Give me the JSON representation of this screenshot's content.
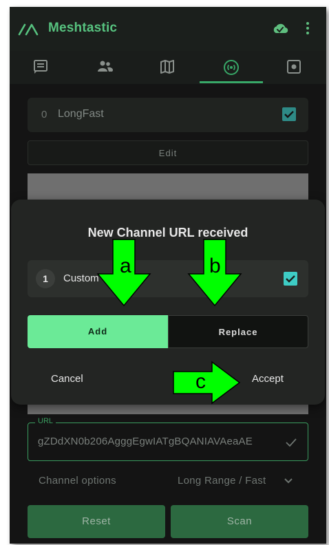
{
  "app": {
    "title": "Meshtastic"
  },
  "tabs": [
    {
      "icon": "chat-icon"
    },
    {
      "icon": "people-icon"
    },
    {
      "icon": "map-icon"
    },
    {
      "icon": "channel-icon",
      "selected": true
    },
    {
      "icon": "settings-icon"
    }
  ],
  "channels": [
    {
      "index": "0",
      "name": "LongFast"
    }
  ],
  "edit_label": "Edit",
  "url_field": {
    "label": "URL",
    "value": "gZDdXN0b206AgggEgwIATgBQANIAVAeaAE"
  },
  "channel_options": {
    "label": "Channel options",
    "value": "Long Range / Fast"
  },
  "buttons": {
    "reset": "Reset",
    "scan": "Scan"
  },
  "dialog": {
    "title": "New Channel URL received",
    "channel": {
      "index": "1",
      "name": "Custom"
    },
    "add": "Add",
    "replace": "Replace",
    "cancel": "Cancel",
    "accept": "Accept"
  },
  "annotations": {
    "a": "a",
    "b": "b",
    "c": "c"
  },
  "colors": {
    "accent": "#57c27f",
    "add_button": "#6bea97",
    "arrow": "#00ff00",
    "checkbox": "#3ecdc5"
  }
}
